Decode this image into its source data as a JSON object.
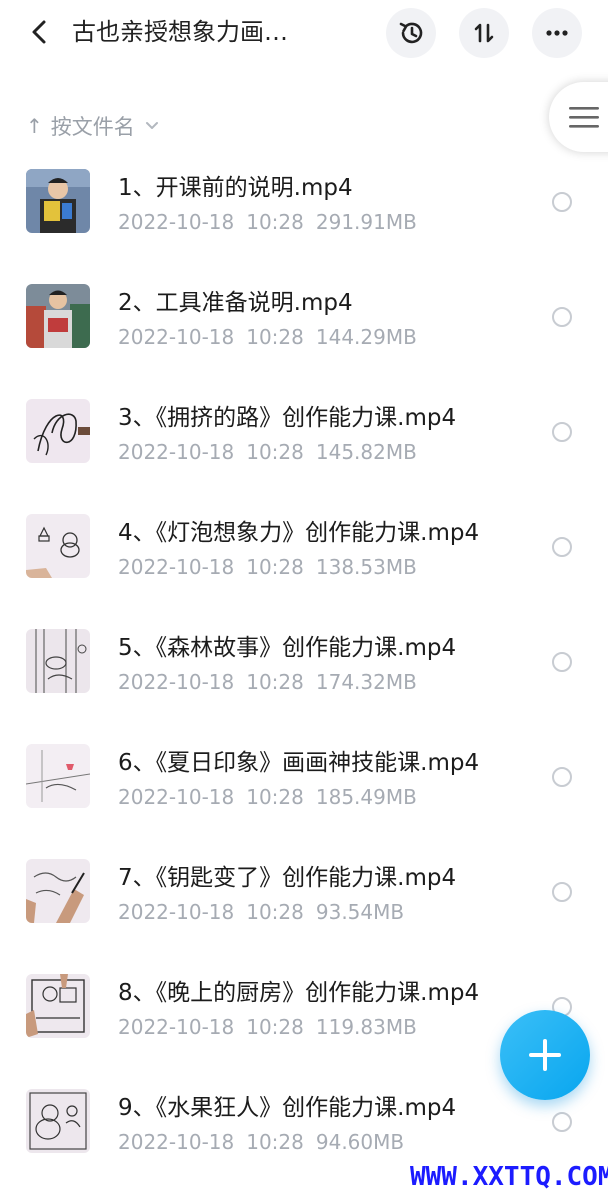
{
  "header": {
    "title": "古也亲授想象力画…",
    "back_icon": "chevron-left-icon",
    "actions": [
      "history-icon",
      "sort-icon",
      "more-icon"
    ]
  },
  "sortbar": {
    "arrow": "↑",
    "label": "按文件名",
    "chevron": "⌄"
  },
  "files": [
    {
      "name": "1、开课前的说明.mp4",
      "date": "2022-10-18",
      "time": "10:28",
      "size": "291.91MB"
    },
    {
      "name": "2、工具准备说明.mp4",
      "date": "2022-10-18",
      "time": "10:28",
      "size": "144.29MB"
    },
    {
      "name": "3、《拥挤的路》创作能力课.mp4",
      "date": "2022-10-18",
      "time": "10:28",
      "size": "145.82MB"
    },
    {
      "name": "4、《灯泡想象力》创作能力课.mp4",
      "date": "2022-10-18",
      "time": "10:28",
      "size": "138.53MB"
    },
    {
      "name": "5、《森林故事》创作能力课.mp4",
      "date": "2022-10-18",
      "time": "10:28",
      "size": "174.32MB"
    },
    {
      "name": "6、《夏日印象》画画神技能课.mp4",
      "date": "2022-10-18",
      "time": "10:28",
      "size": "185.49MB"
    },
    {
      "name": "7、《钥匙变了》创作能力课.mp4",
      "date": "2022-10-18",
      "time": "10:28",
      "size": "93.54MB"
    },
    {
      "name": "8、《晚上的厨房》创作能力课.mp4",
      "date": "2022-10-18",
      "time": "10:28",
      "size": "119.83MB"
    },
    {
      "name": "9、《水果狂人》创作能力课.mp4",
      "date": "2022-10-18",
      "time": "10:28",
      "size": "94.60MB"
    }
  ],
  "fab": {
    "icon": "plus-icon",
    "color": "#1aaef2"
  },
  "watermark": "WWW.XXTTQ.COM"
}
